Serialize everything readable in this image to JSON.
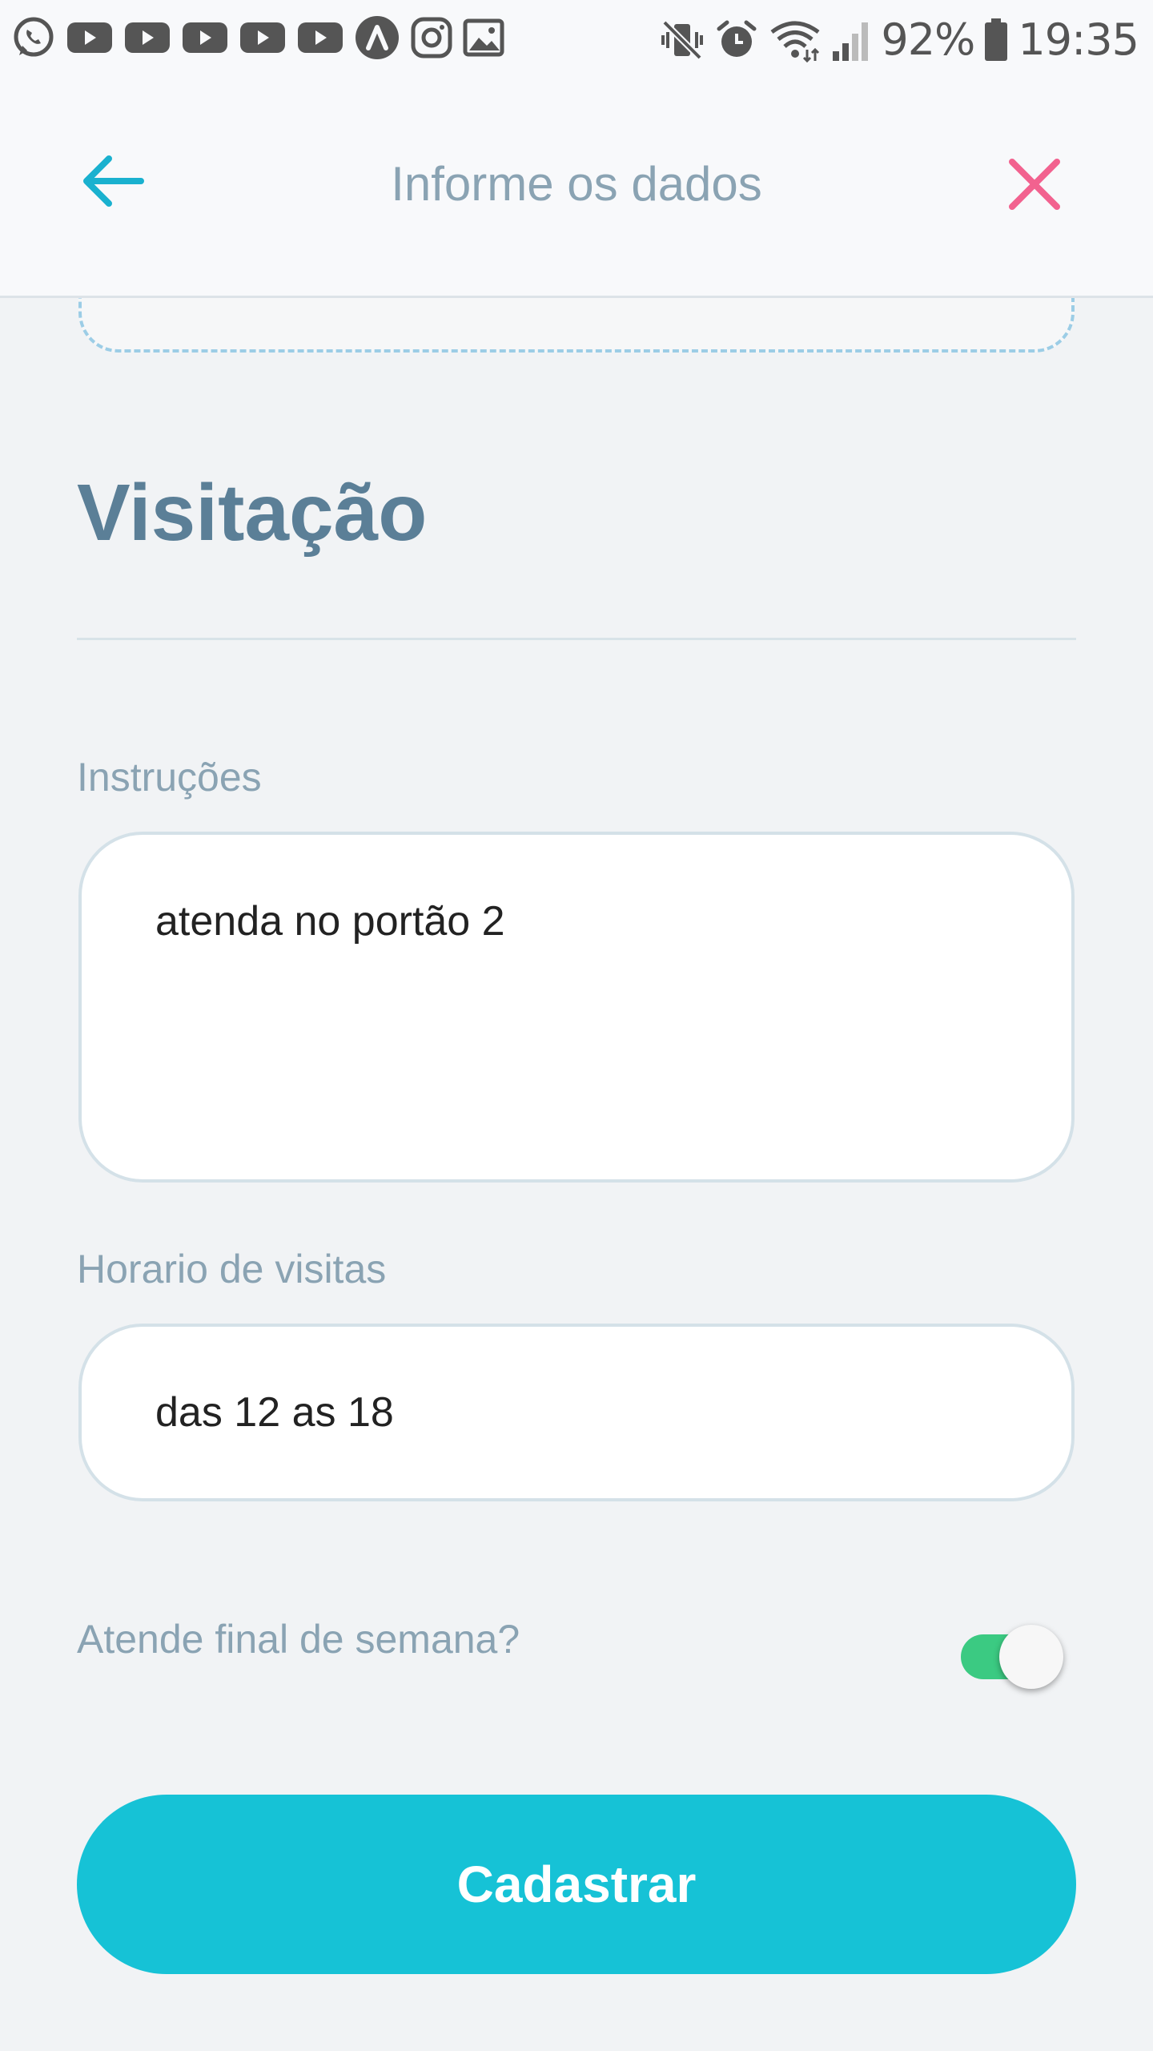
{
  "status_bar": {
    "notification_icons": [
      "whatsapp-icon",
      "youtube-icon",
      "youtube-icon",
      "youtube-icon",
      "youtube-icon",
      "youtube-icon",
      "lambda-app-icon",
      "instagram-icon",
      "gallery-icon"
    ],
    "system_icons": [
      "mute-vibrate-icon",
      "alarm-icon",
      "wifi-icon",
      "signal-icon"
    ],
    "battery": "92%",
    "time": "19:35"
  },
  "header": {
    "title": "Informe os dados",
    "back_icon": "arrow-left-icon",
    "close_icon": "close-icon",
    "accent_color": "#1ab1cf",
    "close_color": "#f2628f"
  },
  "section": {
    "title": "Visitação"
  },
  "form": {
    "instructions": {
      "label": "Instruções",
      "value": "atenda no portão 2"
    },
    "visit_hours": {
      "label": "Horario de visitas",
      "value": "das 12 as 18"
    },
    "weekend": {
      "label": "Atende final de semana?",
      "enabled": true,
      "on_color": "#3bca82"
    }
  },
  "actions": {
    "submit_label": "Cadastrar",
    "submit_color": "#16c2d6"
  }
}
